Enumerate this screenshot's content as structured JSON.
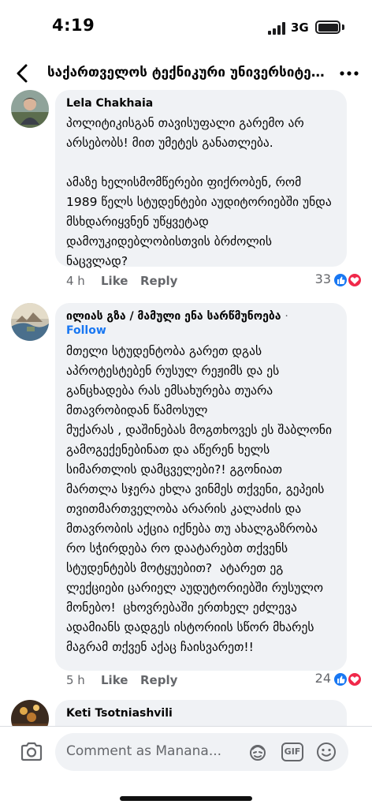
{
  "status_bar": {
    "time": "4:19",
    "network": "3G"
  },
  "header": {
    "title": "საქართველოს ტექნიკური უნივერსიტეტ...",
    "back_icon": "chevron-left-icon",
    "more_icon": "more-horizontal-icon"
  },
  "comments": [
    {
      "author": "Lela Chakhaia",
      "text": "პოლიტიკისგან თავისუფალი გარემო არ არსებობს! მით უმეტეს განათლება.\n\nამაზე ხელისმომწერები ფიქრობენ, რომ 1989 წელს სტუდენტები აუდიტორიებში უნდა მსხდარიყვნენ უწყვეტად დამოუკიდებლობისთვის ბრძოლის ნაცვლად?",
      "time": "4 h",
      "like": "Like",
      "reply": "Reply",
      "reactions": "33"
    },
    {
      "author": "ილიას გზა / მამული ენა სარწმუნოება",
      "separator": "·",
      "follow": "Follow",
      "text": "მთელი სტუდენტობა გარეთ დგას აპროტესტებენ რუსულ რეჟიმს და ეს განცხადება რას ემსახურება თუარა მთავრობიდან წამოსულ\nმუქარას , დაშინებას მოგთხოვეს ეს შაბლონი გამოგექენებინათ და აწერენ ხელს სიმართლის დამცველები?! გგონიათ მართლა სჯერა ეხლა ვინმეს თქვენი, გეპეის თვითმართველობა არარის კალაძის და მთავრობის აქცია იქნება თუ ახალგაზრობა რო სჭირდება რო დაატარებთ თქვენს სტუდენტებს მოტყუებით?  ატარეთ ეგ ლექციები ცარიელ აუდუტორიებში რუსულო მონებო!  ცხოვრებაში ერთხელ ეძლევა ადამიანს დადგეს ისტორიის სწორ მხარეს მაგრამ თქვენ აქაც ჩაისვარეთ!!",
      "time": "5 h",
      "like": "Like",
      "reply": "Reply",
      "reactions": "24"
    },
    {
      "author": "Keti Tsotniashvili"
    }
  ],
  "compose": {
    "placeholder": "Comment as Manana...",
    "gif_label": "GIF"
  },
  "colors": {
    "accent": "#1877f2",
    "love": "#f0284a",
    "bubble": "#f0f2f5",
    "muted": "#65676b"
  }
}
